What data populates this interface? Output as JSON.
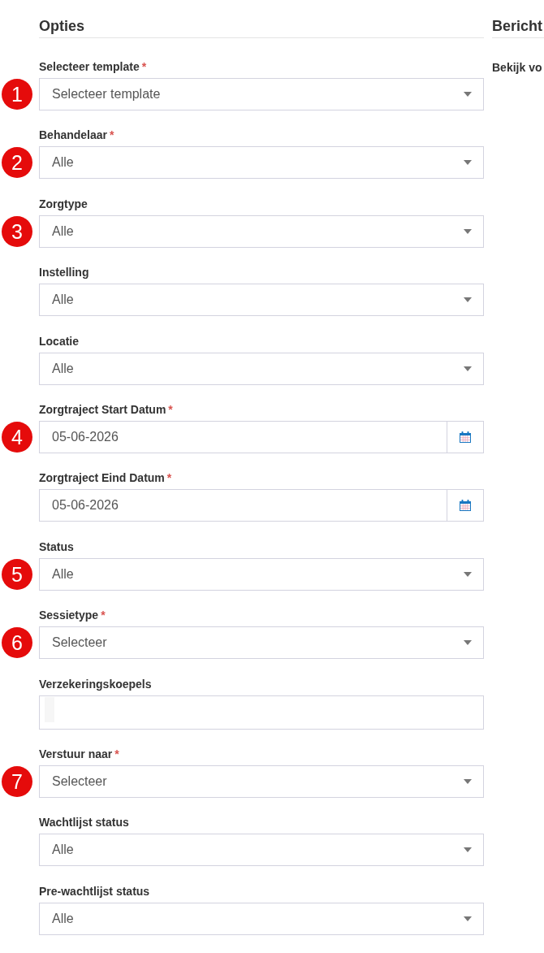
{
  "options": {
    "heading": "Opties",
    "fields": [
      {
        "kind": "select",
        "label": "Selecteer template",
        "required_mark": "*",
        "value": "Selecteer template",
        "marker": "1"
      },
      {
        "kind": "select",
        "label": "Behandelaar",
        "required_mark": "*",
        "value": "Alle",
        "marker": "2"
      },
      {
        "kind": "select",
        "label": "Zorgtype",
        "value": "Alle",
        "marker": "3"
      },
      {
        "kind": "select",
        "label": "Instelling",
        "value": "Alle"
      },
      {
        "kind": "select",
        "label": "Locatie",
        "value": "Alle"
      },
      {
        "kind": "date",
        "label": "Zorgtraject Start Datum",
        "required_mark": "*",
        "value": "05-06-2026",
        "marker": "4"
      },
      {
        "kind": "date",
        "label": "Zorgtraject Eind Datum",
        "required_mark": "*",
        "value": "05-06-2026"
      },
      {
        "kind": "select",
        "label": "Status",
        "value": "Alle",
        "marker": "5"
      },
      {
        "kind": "select",
        "label": "Sessietype",
        "required_mark": "*",
        "value": "Selecteer",
        "marker": "6"
      },
      {
        "kind": "tags",
        "label": "Verzekeringskoepels"
      },
      {
        "kind": "select",
        "label": "Verstuur naar",
        "required_mark": "*",
        "value": "Selecteer",
        "marker": "7"
      },
      {
        "kind": "select",
        "label": "Wachtlijst status",
        "value": "Alle"
      },
      {
        "kind": "select",
        "label": "Pre-wachtlijst status",
        "value": "Alle"
      }
    ]
  },
  "message": {
    "heading": "Bericht",
    "label": "Bekijk vo"
  }
}
